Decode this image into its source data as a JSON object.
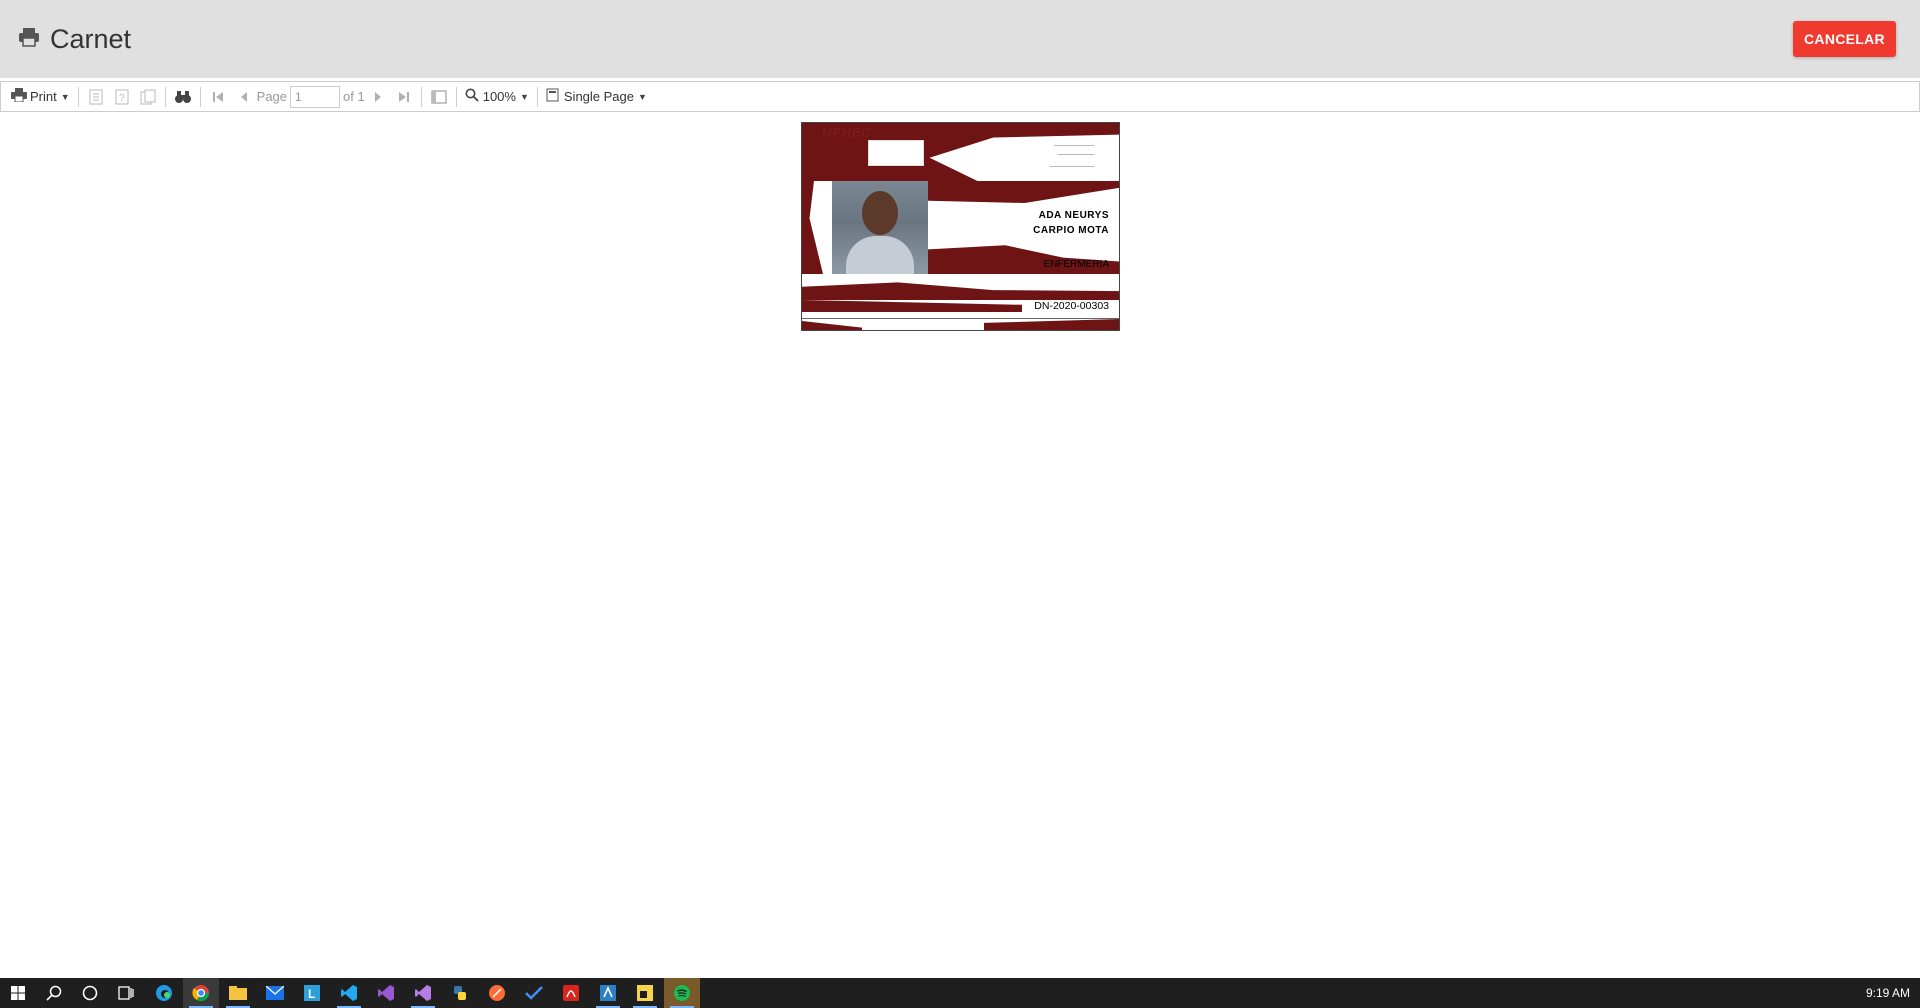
{
  "header": {
    "title": "Carnet",
    "cancel_label": "CANCELAR"
  },
  "toolbar": {
    "print_label": "Print",
    "page_label": "Page",
    "page_value": "1",
    "page_of": "of 1",
    "zoom": "100%",
    "view_mode": "Single Page"
  },
  "card": {
    "logo_text": "UFHEC",
    "name_line1": "ADA NEURYS",
    "name_line2": "CARPIO MOTA",
    "career": "ENFERMERIA",
    "code": "DN-2020-00303"
  },
  "taskbar": {
    "clock": "9:19 AM",
    "apps": [
      "start-icon",
      "search-icon",
      "cortana-icon",
      "task-view-icon",
      "edge-icon",
      "chrome-icon",
      "file-explorer-icon",
      "mail-icon",
      "l-app-icon",
      "vscode-icon",
      "visual-studio-icon",
      "visual-studio-alt-icon",
      "python-icon",
      "postman-icon",
      "todo-icon",
      "acrobat-icon",
      "ssms-icon",
      "sticky-notes-icon",
      "spotify-icon"
    ]
  },
  "colors": {
    "accent": "#f03a2f",
    "card_band": "#6e1414",
    "header_bg": "#e0e0e0",
    "taskbar_bg": "#1f1f1f"
  }
}
